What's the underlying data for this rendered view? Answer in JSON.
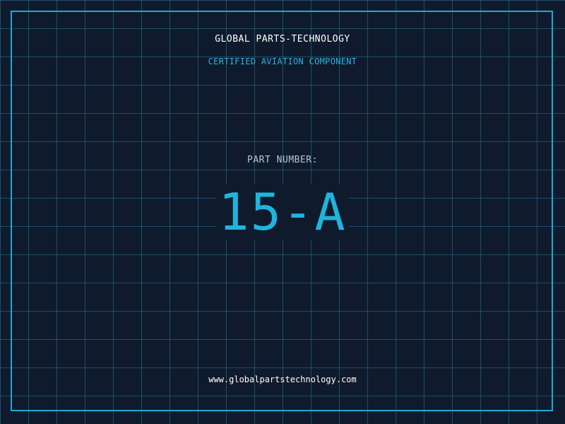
{
  "header": {
    "company": "GLOBAL PARTS-TECHNOLOGY",
    "subtitle": "CERTIFIED AVIATION COMPONENT"
  },
  "part": {
    "label": "PART NUMBER:",
    "number": "15-A"
  },
  "footer": {
    "website": "www.globalpartstechnology.com"
  },
  "colors": {
    "background": "#0f1b2d",
    "grid": "#26789a",
    "accent": "#1fa9d6",
    "label": "#b9c4d0",
    "text": "#ffffff"
  }
}
